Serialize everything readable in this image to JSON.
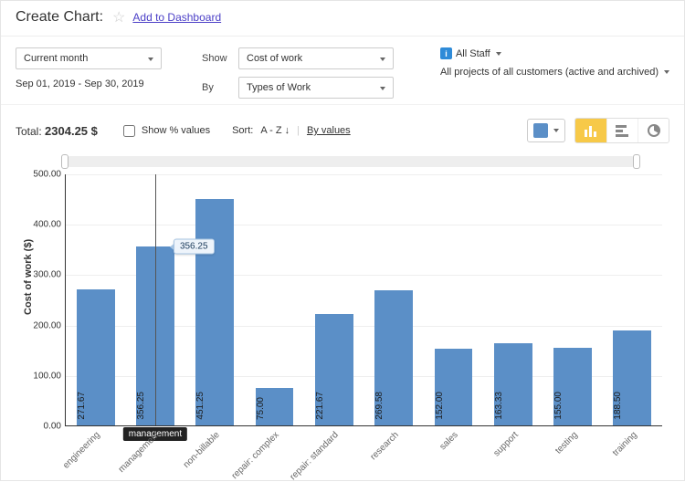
{
  "header": {
    "title": "Create Chart:",
    "add_link": "Add to Dashboard"
  },
  "controls": {
    "period": "Current month",
    "date_range": "Sep 01, 2019  -  Sep 30, 2019",
    "show_label": "Show",
    "show_value": "Cost of work",
    "by_label": "By",
    "by_value": "Types of Work",
    "staff_filter": "All Staff",
    "projects_filter": "All projects of all customers (active and archived)"
  },
  "summary": {
    "total_label": "Total:",
    "total_value": "2304.25 $",
    "show_pct_label": "Show % values",
    "sort_label": "Sort:",
    "sort_az": "A - Z",
    "sort_values": "By values"
  },
  "color_dropdown": {
    "swatch": "#5b8fc7"
  },
  "chart_types": [
    "bar",
    "hbar",
    "pie"
  ],
  "chart_data": {
    "type": "bar",
    "title": "",
    "xlabel": "",
    "ylabel": "Cost of work  ($)",
    "ylim": [
      0,
      500
    ],
    "yticks": [
      0,
      100,
      200,
      300,
      400,
      500
    ],
    "hover_category": "management",
    "hover_value": "356.25",
    "categories": [
      "engineering",
      "management",
      "non-billable",
      "repair: complex",
      "repair: standard",
      "research",
      "sales",
      "support",
      "testing",
      "training"
    ],
    "values": [
      271.67,
      356.25,
      451.25,
      75.0,
      221.67,
      269.58,
      152.0,
      163.33,
      155.0,
      188.5
    ],
    "value_labels": [
      "271.67",
      "356.25",
      "451.25",
      "75.00",
      "221.67",
      "269.58",
      "152.00",
      "163.33",
      "155.00",
      "188.50"
    ]
  }
}
